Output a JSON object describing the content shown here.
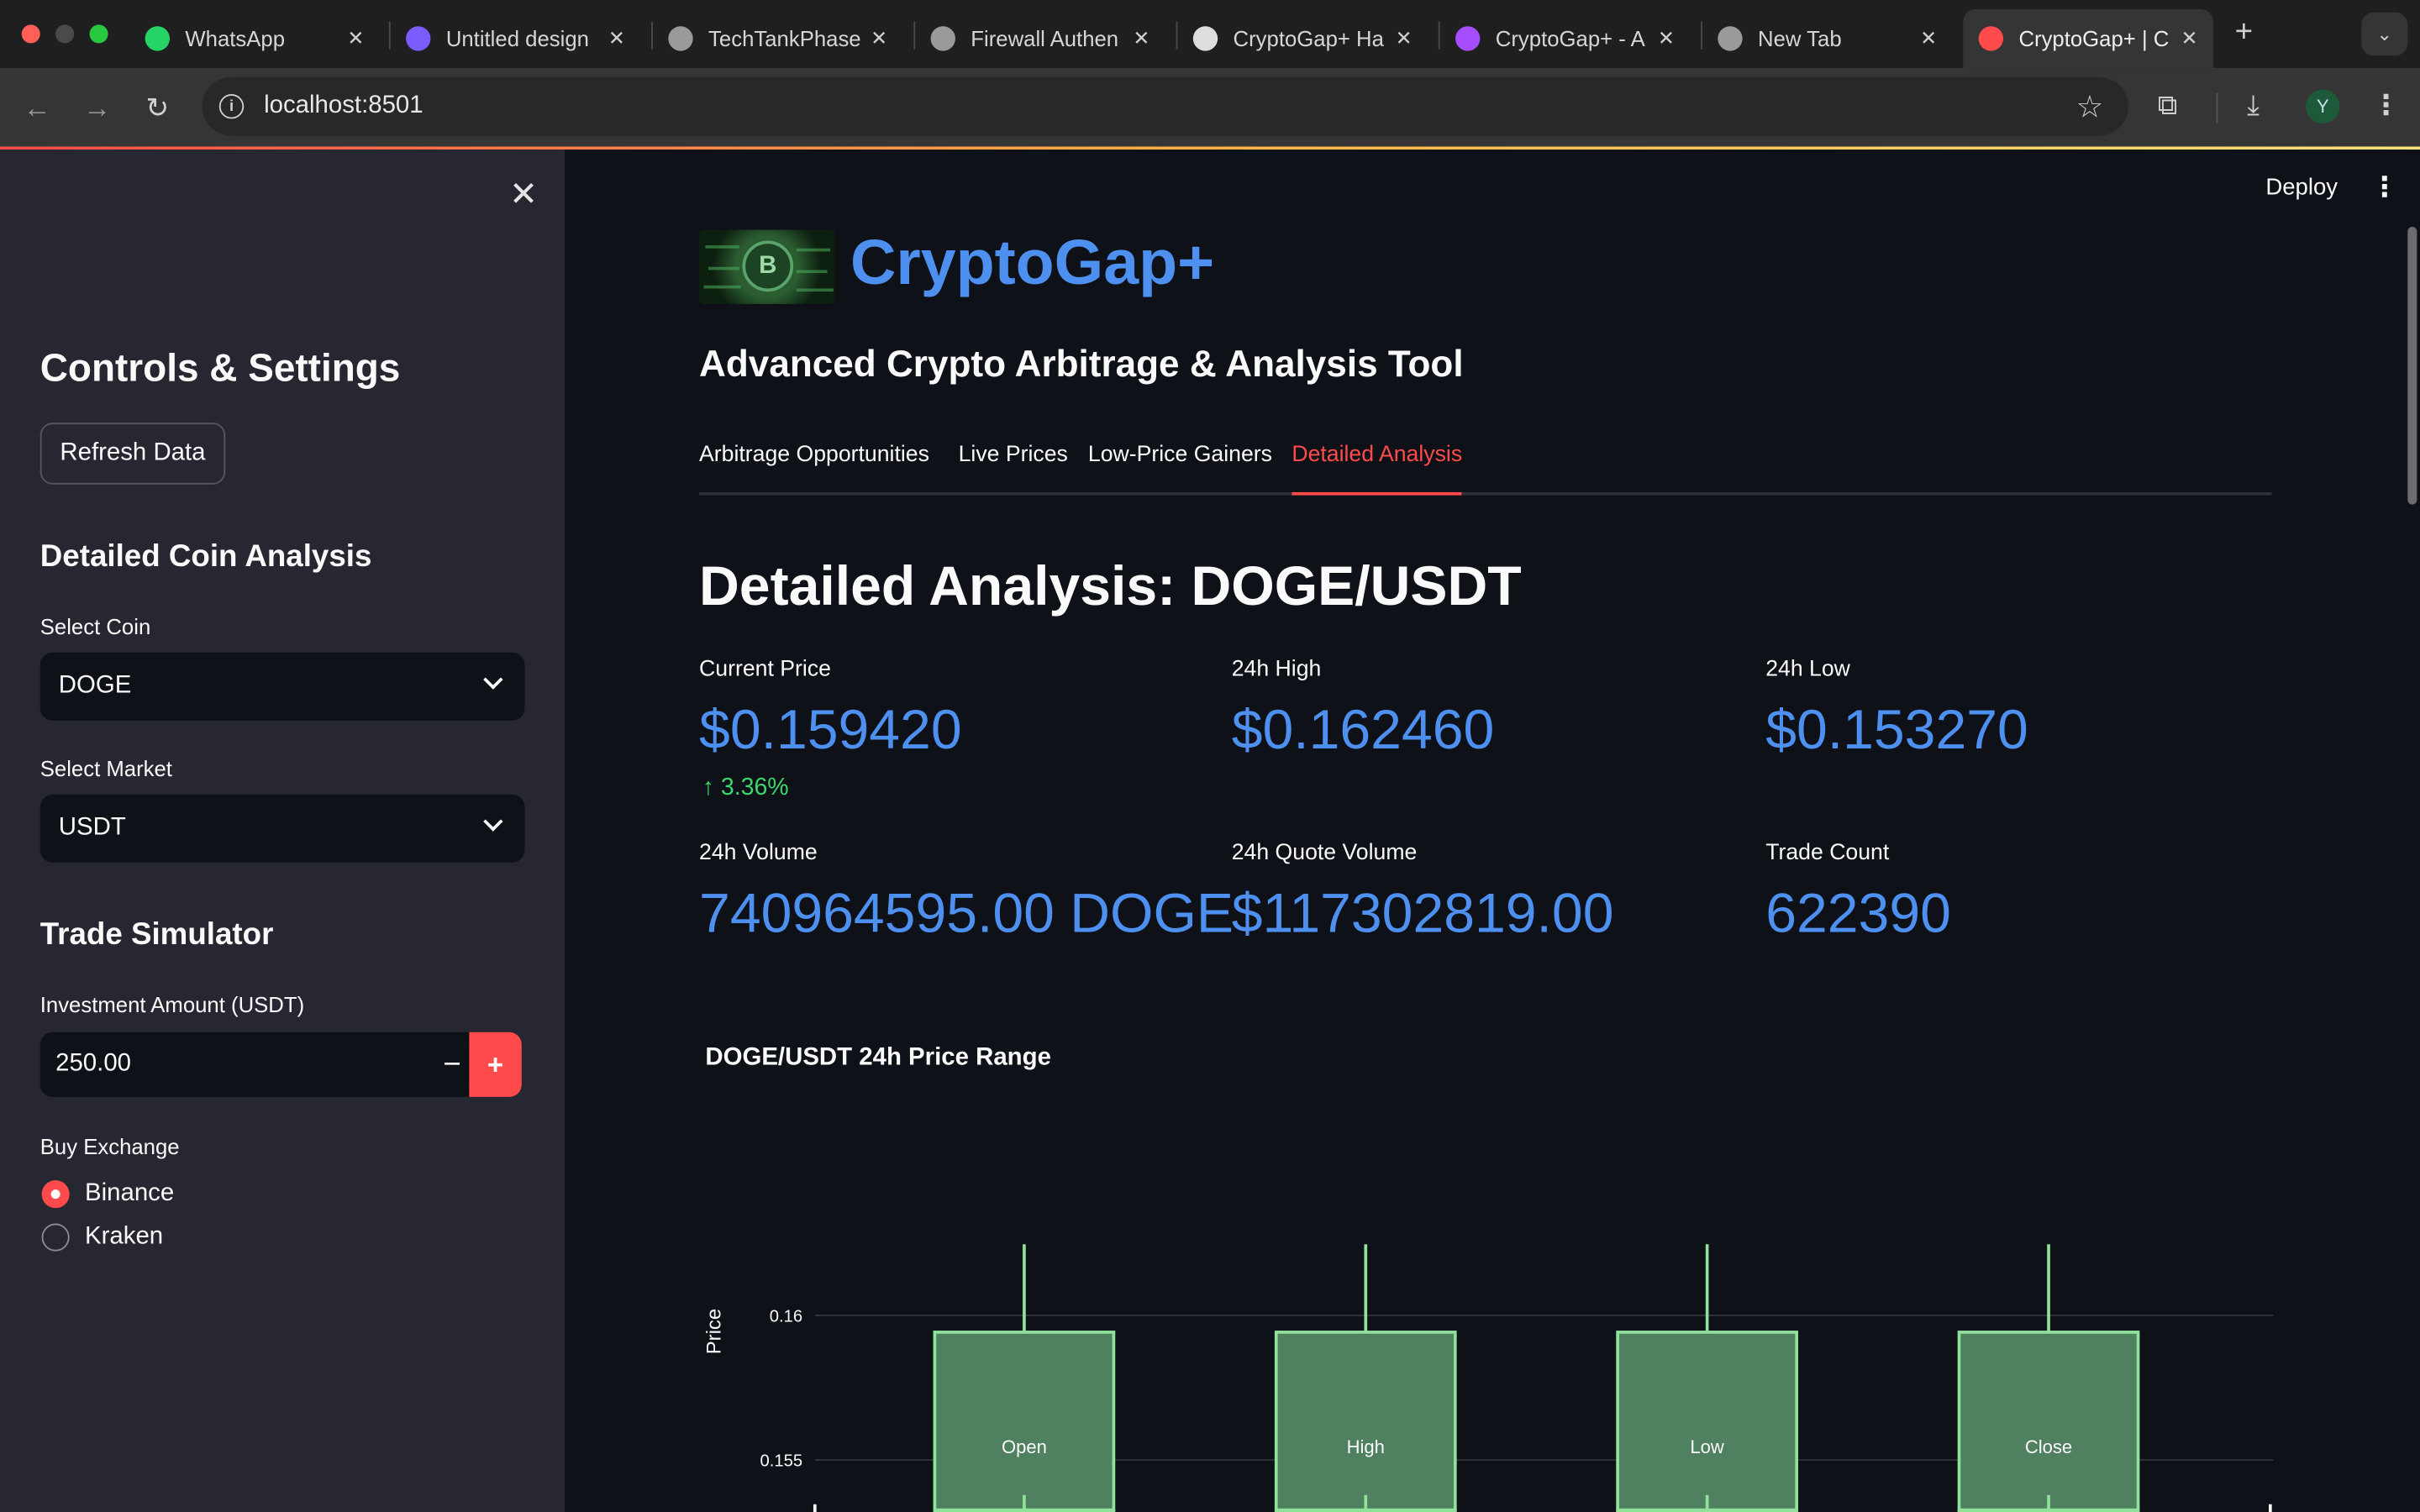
{
  "browser": {
    "tabs": [
      {
        "label": "WhatsApp",
        "icon": "whatsapp-icon",
        "color": "#25d366"
      },
      {
        "label": "Untitled design",
        "icon": "canva-icon",
        "color": "#7b5cff"
      },
      {
        "label": "TechTankPhase",
        "icon": "globe-icon",
        "color": "#9a9a9a"
      },
      {
        "label": "Firewall Authen",
        "icon": "globe-icon",
        "color": "#9a9a9a"
      },
      {
        "label": "CryptoGap+ Ha",
        "icon": "openai-icon",
        "color": "#dddddd"
      },
      {
        "label": "CryptoGap+ - A",
        "icon": "cube-icon",
        "color": "#a64dff"
      },
      {
        "label": "New Tab",
        "icon": "chrome-icon",
        "color": "#9a9a9a"
      },
      {
        "label": "CryptoGap+ | C",
        "icon": "chart-icon",
        "color": "#ff4b4b",
        "active": true
      }
    ],
    "url": "localhost:8501",
    "avatar_letter": "Y"
  },
  "sidebar": {
    "heading": "Controls & Settings",
    "refresh_label": "Refresh Data",
    "analysis_heading": "Detailed Coin Analysis",
    "coin_label": "Select Coin",
    "coin_value": "DOGE",
    "market_label": "Select Market",
    "market_value": "USDT",
    "simulator_heading": "Trade Simulator",
    "investment_label": "Investment Amount (USDT)",
    "investment_value": "250.00",
    "exchange_label": "Buy Exchange",
    "exchange_options": [
      "Binance",
      "Kraken"
    ],
    "exchange_selected": "Binance"
  },
  "header": {
    "deploy_label": "Deploy",
    "app_title": "CryptoGap+",
    "app_subtitle": "Advanced Crypto Arbitrage & Analysis Tool"
  },
  "tabs": [
    {
      "label": "Arbitrage Opportunities"
    },
    {
      "label": "Live Prices"
    },
    {
      "label": "Low-Price Gainers"
    },
    {
      "label": "Detailed Analysis",
      "active": true
    }
  ],
  "analysis": {
    "title": "Detailed Analysis: DOGE/USDT",
    "metrics": [
      {
        "label": "Current Price",
        "value": "$0.159420",
        "delta": "3.36%"
      },
      {
        "label": "24h High",
        "value": "$0.162460"
      },
      {
        "label": "24h Low",
        "value": "$0.153270"
      },
      {
        "label": "24h Volume",
        "value": "740964595.00 DOGE"
      },
      {
        "label": "24h Quote Volume",
        "value": "$117302819.00"
      },
      {
        "label": "Trade Count",
        "value": "622390"
      }
    ]
  },
  "colors": {
    "accent": "#ff4b4b",
    "metric_blue": "#4d90f0",
    "delta_green": "#3dd56d",
    "candle_fill": "#4f8060",
    "candle_line": "#90e29a"
  },
  "chart_data": {
    "type": "candlestick",
    "title": "DOGE/USDT 24h Price Range",
    "ylabel": "Price",
    "categories": [
      "Open",
      "High",
      "Low",
      "Close"
    ],
    "ohlc": [
      {
        "open": 0.15327,
        "high": 0.16246,
        "low": 0.15327,
        "close": 0.15942
      },
      {
        "open": 0.15327,
        "high": 0.16246,
        "low": 0.15327,
        "close": 0.15942
      },
      {
        "open": 0.15327,
        "high": 0.16246,
        "low": 0.15327,
        "close": 0.15942
      },
      {
        "open": 0.15327,
        "high": 0.16246,
        "low": 0.15327,
        "close": 0.15942
      }
    ],
    "y_ticks": [
      0.155,
      0.16
    ],
    "y_tick_labels": [
      "0.155",
      "0.16"
    ],
    "ylim": [
      0.1524,
      0.1651
    ],
    "grid": true
  }
}
